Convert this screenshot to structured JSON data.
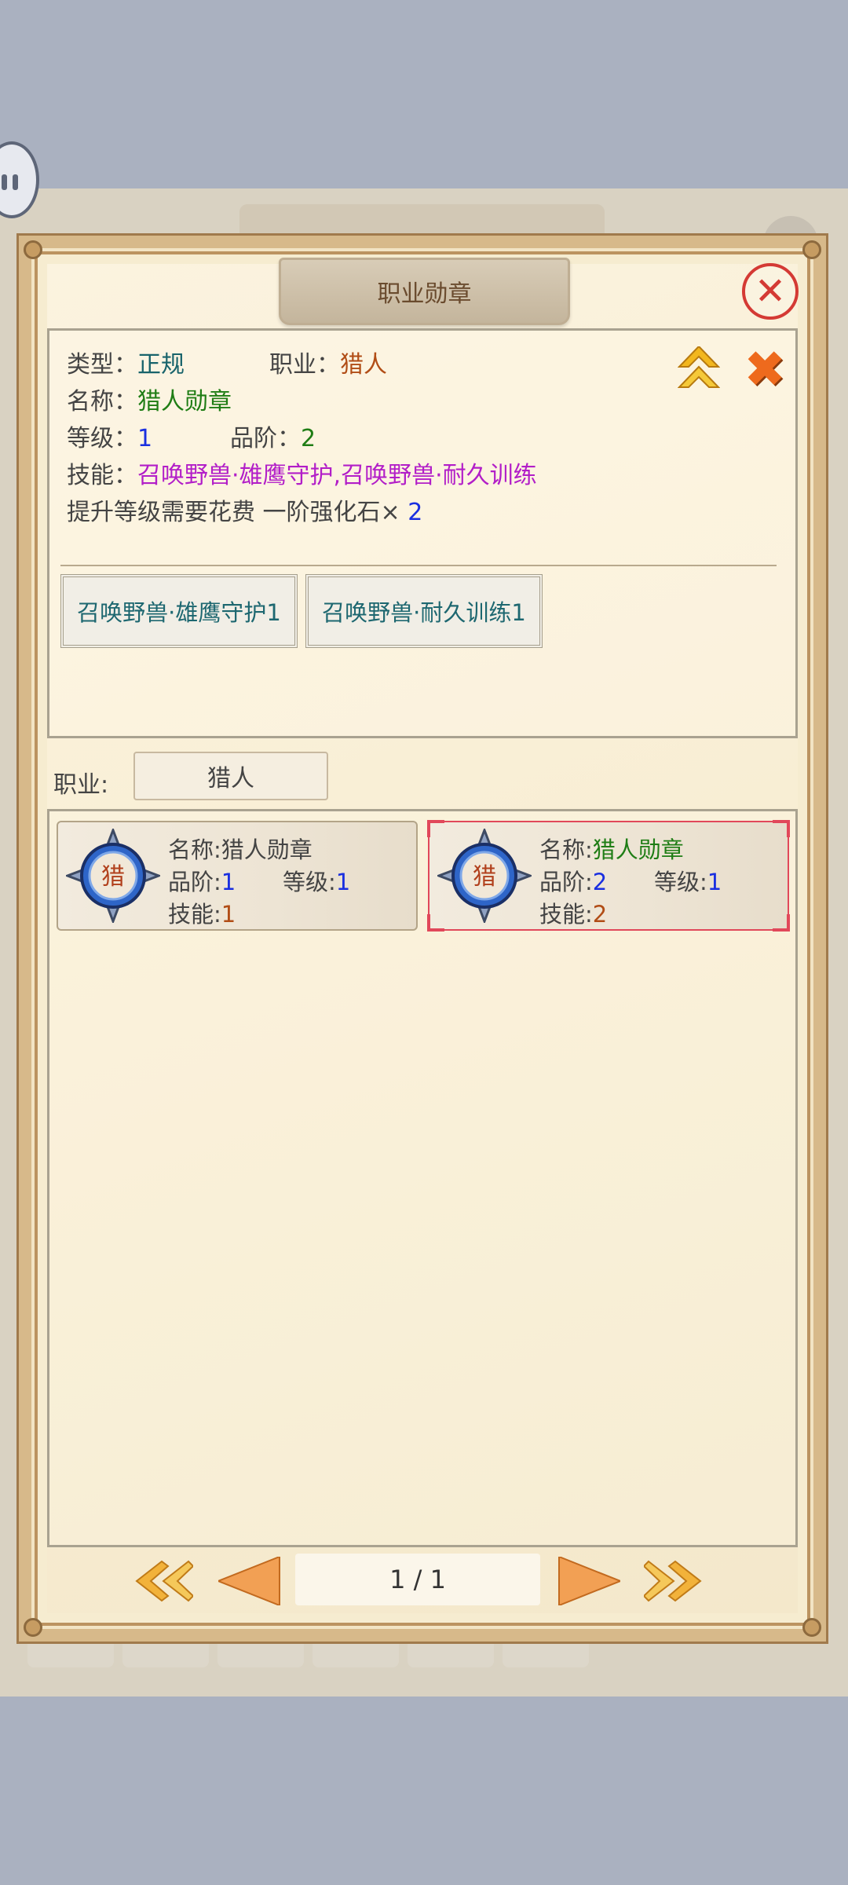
{
  "dialog": {
    "title": "职业勋章",
    "close_icon": "close-icon"
  },
  "info": {
    "type_label": "类型：",
    "type_value": "正规",
    "job_label": "职业：",
    "job_value": "猎人",
    "name_label": "名称：",
    "name_value": "猎人勋章",
    "level_label": "等级：",
    "level_value": "1",
    "grade_label": "品阶：",
    "grade_value": "2",
    "skill_label": "技能：",
    "skill_value": "召唤野兽·雄鹰守护,召唤野兽·耐久训练",
    "upgrade_label": "提升等级需要花费 一阶强化石×",
    "upgrade_value": "2",
    "skill_buttons": [
      "召唤野兽·雄鹰守护1",
      "召唤野兽·耐久训练1"
    ],
    "icons": [
      "upgrade-arrow-icon",
      "remove-x-icon"
    ]
  },
  "filter": {
    "label": "职业:",
    "value": "猎人"
  },
  "cards": [
    {
      "medal_char": "猎",
      "name_label": "名称:",
      "name_value": "猎人勋章",
      "grade_label": "品阶:",
      "grade_value": "1",
      "level_label": "等级:",
      "level_value": "1",
      "skill_label": "技能:",
      "skill_value": "1",
      "selected": false
    },
    {
      "medal_char": "猎",
      "name_label": "名称:",
      "name_value": "猎人勋章",
      "grade_label": "品阶:",
      "grade_value": "2",
      "level_label": "等级:",
      "level_value": "1",
      "skill_label": "技能:",
      "skill_value": "2",
      "selected": true
    }
  ],
  "pager": {
    "page_text": "1 / 1",
    "icons": [
      "first-page-icon",
      "prev-page-icon",
      "next-page-icon",
      "last-page-icon"
    ]
  },
  "colors": {
    "teal": "#18636b",
    "brown": "#b14d16",
    "green": "#1f7d15",
    "blue": "#1a2fe0",
    "magenta": "#b21ec8",
    "close_red": "#d43a34",
    "orange_icon": "#ee6a1d"
  }
}
